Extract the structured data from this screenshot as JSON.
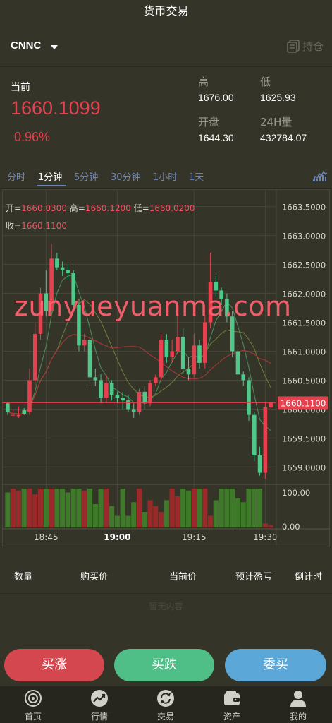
{
  "header": {
    "title": "货币交易"
  },
  "symbol": {
    "name": "CNNC",
    "positions_label": "持仓"
  },
  "ticker": {
    "current_label": "当前",
    "price": "1660.1099",
    "change_pct": "0.96%",
    "high_label": "高",
    "high": "1676.00",
    "low_label": "低",
    "low": "1625.93",
    "open_label": "开盘",
    "open": "1644.30",
    "vol_label": "24H量",
    "vol": "432784.07"
  },
  "tabs": [
    {
      "label": "分时",
      "active": false
    },
    {
      "label": "1分钟",
      "active": true
    },
    {
      "label": "5分钟",
      "active": false
    },
    {
      "label": "30分钟",
      "active": false
    },
    {
      "label": "1小时",
      "active": false
    },
    {
      "label": "1天",
      "active": false
    }
  ],
  "ohlc": {
    "open_label": "开=",
    "open": "1660.0300",
    "high_label": "高=",
    "high": "1660.1200",
    "low_label": "低=",
    "low": "1660.0200",
    "close_label": "收=",
    "close": "1660.1100"
  },
  "watermark": "zunyueyuanma.com",
  "chart_data": {
    "type": "candlestick",
    "y_ticks": [
      "1663.5000",
      "1663.0000",
      "1662.5000",
      "1662.0000",
      "1661.5000",
      "1661.0000",
      "1660.5000",
      "1660.0000",
      "1659.5000",
      "1659.0000"
    ],
    "ylim": [
      1658.7,
      1663.8
    ],
    "current_value": 1660.11,
    "current_label": "1660.1100",
    "x_ticks": [
      "18:45",
      "19:00",
      "19:15",
      "19:30"
    ],
    "volume_ticks": [
      "100.00",
      "0.00"
    ],
    "colors": {
      "up": "#e5414f",
      "down": "#4ec98a",
      "ma1": "#a83838",
      "ma2": "#4a8a5a",
      "ma3": "#6b7a3a"
    },
    "candles": [
      [
        1660.1,
        1660.12,
        1659.95,
        1659.9
      ],
      [
        1659.9,
        1660.0,
        1659.9,
        1659.88
      ],
      [
        1659.88,
        1660.05,
        1659.9,
        1659.85
      ],
      [
        1659.98,
        1660.02,
        1659.92,
        1659.9
      ],
      [
        1659.95,
        1660.7,
        1660.5,
        1659.9
      ],
      [
        1660.5,
        1661.5,
        1661.3,
        1660.4
      ],
      [
        1661.3,
        1662.1,
        1662.0,
        1661.2
      ],
      [
        1662.0,
        1662.4,
        1661.7,
        1661.6
      ],
      [
        1661.7,
        1662.85,
        1662.6,
        1661.6
      ],
      [
        1662.6,
        1662.7,
        1662.45,
        1662.4
      ],
      [
        1662.45,
        1662.55,
        1662.4,
        1662.3
      ],
      [
        1662.4,
        1662.5,
        1662.35,
        1662.25
      ],
      [
        1662.35,
        1662.4,
        1661.8,
        1661.7
      ],
      [
        1661.8,
        1661.9,
        1661.1,
        1661.0
      ],
      [
        1661.1,
        1661.3,
        1661.2,
        1661.0
      ],
      [
        1661.2,
        1661.3,
        1660.55,
        1660.4
      ],
      [
        1660.55,
        1660.7,
        1660.5,
        1660.4
      ],
      [
        1660.5,
        1660.6,
        1660.2,
        1660.1
      ],
      [
        1660.2,
        1660.6,
        1660.45,
        1660.1
      ],
      [
        1660.45,
        1660.5,
        1660.25,
        1660.15
      ],
      [
        1660.25,
        1660.3,
        1660.2,
        1660.1
      ],
      [
        1660.2,
        1660.3,
        1660.15,
        1660.0
      ],
      [
        1660.15,
        1660.25,
        1660.0,
        1659.95
      ],
      [
        1660.0,
        1660.1,
        1659.95,
        1659.85
      ],
      [
        1659.95,
        1660.35,
        1660.3,
        1659.9
      ],
      [
        1660.3,
        1660.4,
        1660.1,
        1660.0
      ],
      [
        1660.1,
        1660.5,
        1660.45,
        1660.05
      ],
      [
        1660.45,
        1660.6,
        1660.55,
        1660.4
      ],
      [
        1660.55,
        1661.3,
        1661.2,
        1660.5
      ],
      [
        1661.2,
        1661.3,
        1660.9,
        1660.8
      ],
      [
        1660.9,
        1661.2,
        1661.0,
        1660.8
      ],
      [
        1661.0,
        1661.7,
        1661.25,
        1660.95
      ],
      [
        1661.25,
        1661.4,
        1660.7,
        1660.6
      ],
      [
        1660.7,
        1660.9,
        1660.6,
        1660.5
      ],
      [
        1660.6,
        1661.3,
        1661.1,
        1660.55
      ],
      [
        1661.1,
        1661.2,
        1660.8,
        1660.7
      ],
      [
        1660.8,
        1661.6,
        1661.5,
        1660.7
      ],
      [
        1661.5,
        1662.7,
        1662.2,
        1661.4
      ],
      [
        1662.2,
        1662.3,
        1662.05,
        1661.95
      ],
      [
        1662.05,
        1662.1,
        1661.9,
        1661.8
      ],
      [
        1661.9,
        1662.0,
        1661.6,
        1661.5
      ],
      [
        1661.6,
        1661.7,
        1661.0,
        1660.9
      ],
      [
        1661.0,
        1661.1,
        1660.6,
        1660.5
      ],
      [
        1660.6,
        1660.65,
        1660.5,
        1660.4
      ],
      [
        1660.5,
        1660.55,
        1659.9,
        1659.8
      ],
      [
        1659.9,
        1659.95,
        1659.2,
        1659.1
      ],
      [
        1659.2,
        1659.35,
        1658.9,
        1658.85
      ],
      [
        1658.9,
        1660.12,
        1660.03,
        1658.8
      ],
      [
        1660.03,
        1660.12,
        1660.11,
        1660.02
      ]
    ],
    "volume": [
      90,
      100,
      95,
      100,
      100,
      85,
      100,
      100,
      100,
      100,
      100,
      90,
      100,
      100,
      95,
      100,
      60,
      100,
      100,
      55,
      30,
      100,
      30,
      65,
      100,
      40,
      70,
      55,
      40,
      70,
      100,
      80,
      100,
      95,
      100,
      100,
      100,
      30,
      70,
      100,
      100,
      100,
      75,
      65,
      100,
      100,
      100,
      10,
      5
    ]
  },
  "table": {
    "headers": [
      "数量",
      "购买价",
      "当前价",
      "预计盈亏",
      "倒计时"
    ],
    "empty_text": "暂无内容"
  },
  "buttons": {
    "buy_up": "买涨",
    "buy_down": "买跌",
    "entrust": "委买"
  },
  "nav": [
    {
      "label": "首页",
      "icon": "home-icon"
    },
    {
      "label": "行情",
      "icon": "market-icon"
    },
    {
      "label": "交易",
      "icon": "trade-icon"
    },
    {
      "label": "资产",
      "icon": "wallet-icon"
    },
    {
      "label": "我的",
      "icon": "user-icon"
    }
  ]
}
